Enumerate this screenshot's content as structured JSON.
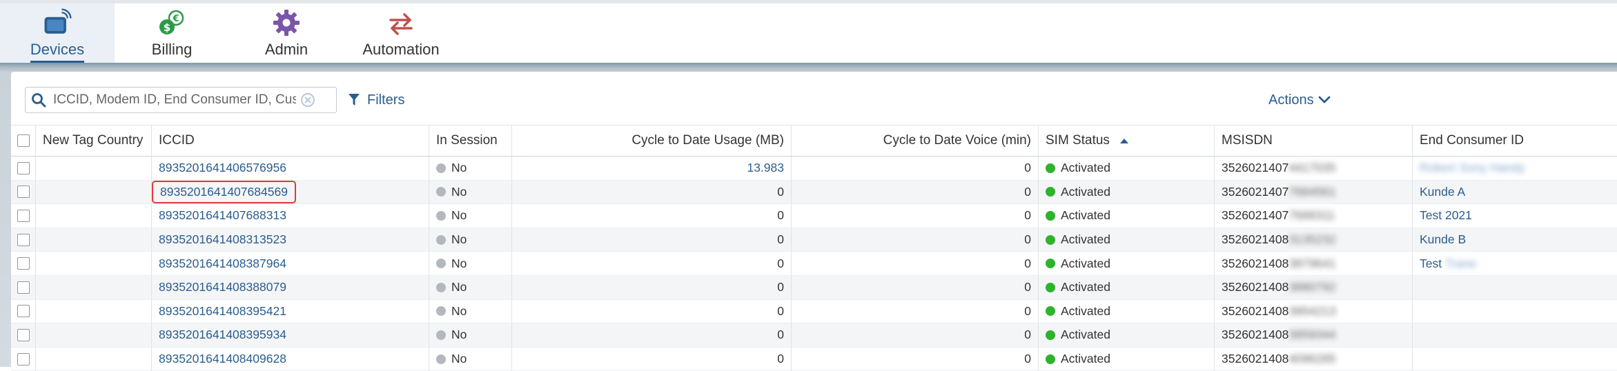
{
  "nav": {
    "items": [
      {
        "label": "Devices",
        "icon": "devices-icon",
        "active": true
      },
      {
        "label": "Billing",
        "icon": "billing-icon",
        "active": false
      },
      {
        "label": "Admin",
        "icon": "gear-icon",
        "active": false
      },
      {
        "label": "Automation",
        "icon": "automation-icon",
        "active": false
      }
    ]
  },
  "toolbar": {
    "search_placeholder": "ICCID, Modem ID, End Consumer ID, Customer",
    "filters_label": "Filters",
    "actions_label": "Actions"
  },
  "table": {
    "columns": {
      "tag": "New Tag Country",
      "iccid": "ICCID",
      "session": "In Session",
      "usage": "Cycle to Date Usage (MB)",
      "voice": "Cycle to Date Voice (min)",
      "status": "SIM Status",
      "msisdn": "MSISDN",
      "ecid": "End Consumer ID"
    },
    "rows": [
      {
        "iccid": "8935201641406576956",
        "session": "No",
        "usage": "13.983",
        "voice": "0",
        "status": "Activated",
        "msisdn": "3526021407",
        "msisdn_hidden": "4417035",
        "ecid": "",
        "ecid_hidden": "Robert Sony Handy"
      },
      {
        "iccid": "8935201641407684569",
        "session": "No",
        "usage": "0",
        "voice": "0",
        "status": "Activated",
        "msisdn": "3526021407",
        "msisdn_hidden": "7684561",
        "ecid": "Kunde A",
        "ecid_hidden": ""
      },
      {
        "iccid": "8935201641407688313",
        "session": "No",
        "usage": "0",
        "voice": "0",
        "status": "Activated",
        "msisdn": "3526021407",
        "msisdn_hidden": "7688311",
        "ecid": "Test 2021",
        "ecid_hidden": ""
      },
      {
        "iccid": "8935201641408313523",
        "session": "No",
        "usage": "0",
        "voice": "0",
        "status": "Activated",
        "msisdn": "3526021408",
        "msisdn_hidden": "3135232",
        "ecid": "Kunde B",
        "ecid_hidden": ""
      },
      {
        "iccid": "8935201641408387964",
        "session": "No",
        "usage": "0",
        "voice": "0",
        "status": "Activated",
        "msisdn": "3526021408",
        "msisdn_hidden": "3879641",
        "ecid": "Test",
        "ecid_hidden": "Trane"
      },
      {
        "iccid": "8935201641408388079",
        "session": "No",
        "usage": "0",
        "voice": "0",
        "status": "Activated",
        "msisdn": "3526021408",
        "msisdn_hidden": "3880792",
        "ecid": "",
        "ecid_hidden": ""
      },
      {
        "iccid": "8935201641408395421",
        "session": "No",
        "usage": "0",
        "voice": "0",
        "status": "Activated",
        "msisdn": "3526021408",
        "msisdn_hidden": "3954213",
        "ecid": "",
        "ecid_hidden": ""
      },
      {
        "iccid": "8935201641408395934",
        "session": "No",
        "usage": "0",
        "voice": "0",
        "status": "Activated",
        "msisdn": "3526021408",
        "msisdn_hidden": "3959344",
        "ecid": "",
        "ecid_hidden": ""
      },
      {
        "iccid": "8935201641408409628",
        "session": "No",
        "usage": "0",
        "voice": "0",
        "status": "Activated",
        "msisdn": "3526021408",
        "msisdn_hidden": "4096285",
        "ecid": "",
        "ecid_hidden": ""
      }
    ]
  },
  "colors": {
    "accent": "#2a5d8f",
    "active_dot": "#2db32d",
    "inactive_dot": "#b4b8bc",
    "highlight": "#e0393e"
  }
}
